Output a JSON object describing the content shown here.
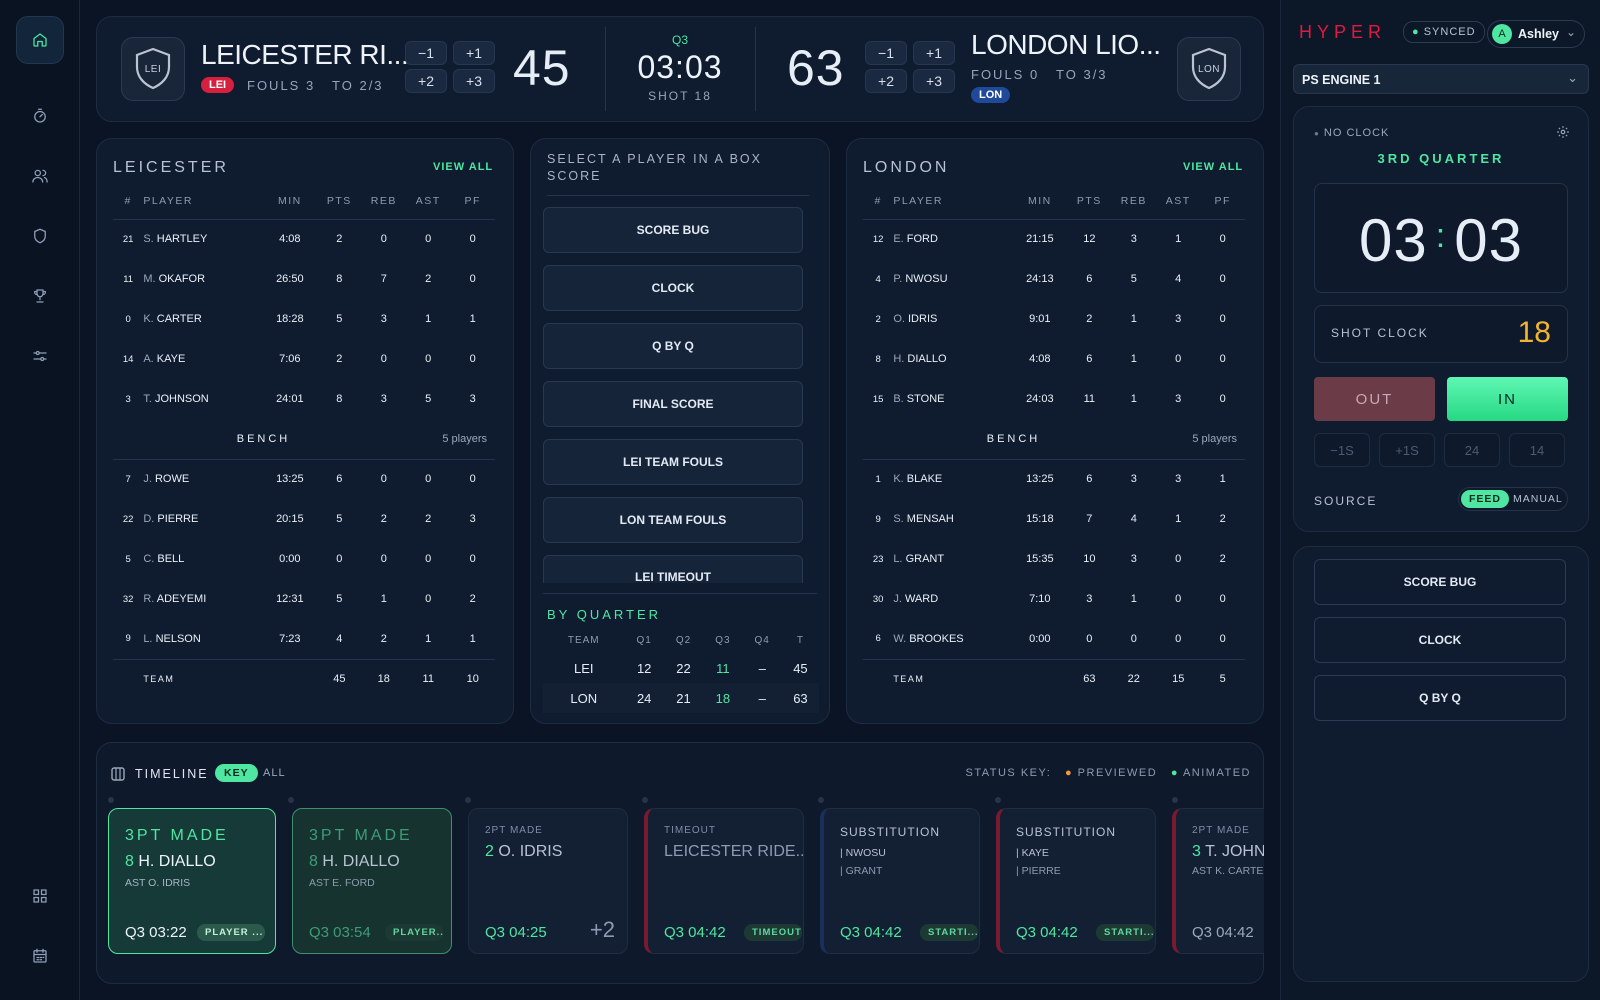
{
  "brand": {
    "logo": "HYPER",
    "sync_status": "SYNCED",
    "user_initial": "A",
    "user_name": "Ashley"
  },
  "engine": {
    "selected": "PS ENGINE 1"
  },
  "nav": {
    "icons": [
      "home-icon",
      "stopwatch-icon",
      "users-icon",
      "shield-icon",
      "trophy-icon",
      "sliders-icon",
      "grid-icon",
      "calendar-icon"
    ]
  },
  "scoreboard": {
    "home": {
      "name": "LEICESTER RI...",
      "abbr": "LEI",
      "fouls": "FOULS 3",
      "timeouts": "TO 2/3",
      "score": "45",
      "crest": "LEI",
      "color": "#d6203e"
    },
    "away": {
      "name": "LONDON LIO...",
      "abbr": "LON",
      "fouls": "FOULS 0",
      "timeouts": "TO 3/3",
      "score": "63",
      "crest": "LON",
      "color": "#1f4a9a"
    },
    "adjust": [
      "−1",
      "+1",
      "+2",
      "+3"
    ],
    "period": "Q3",
    "clock": "03:03",
    "shot": "SHOT 18"
  },
  "headers": [
    "#",
    "PLAYER",
    "MIN",
    "PTS",
    "REB",
    "AST",
    "PF"
  ],
  "leicester": {
    "title": "LEICESTER",
    "view_all": "VIEW ALL",
    "starters": [
      {
        "no": "21",
        "ini": "S.",
        "name": "HARTLEY",
        "min": "4:08",
        "pts": "2",
        "reb": "0",
        "ast": "0",
        "pf": "0"
      },
      {
        "no": "11",
        "ini": "M.",
        "name": "OKAFOR",
        "min": "26:50",
        "pts": "8",
        "reb": "7",
        "ast": "2",
        "pf": "0"
      },
      {
        "no": "0",
        "ini": "K.",
        "name": "CARTER",
        "min": "18:28",
        "pts": "5",
        "reb": "3",
        "ast": "1",
        "pf": "1"
      },
      {
        "no": "14",
        "ini": "A.",
        "name": "KAYE",
        "min": "7:06",
        "pts": "2",
        "reb": "0",
        "ast": "0",
        "pf": "0"
      },
      {
        "no": "3",
        "ini": "T.",
        "name": "JOHNSON",
        "min": "24:01",
        "pts": "8",
        "reb": "3",
        "ast": "5",
        "pf": "3"
      }
    ],
    "bench_label": "BENCH",
    "bench_count": "5 players",
    "bench": [
      {
        "no": "7",
        "ini": "J.",
        "name": "ROWE",
        "min": "13:25",
        "pts": "6",
        "reb": "0",
        "ast": "0",
        "pf": "0"
      },
      {
        "no": "22",
        "ini": "D.",
        "name": "PIERRE",
        "min": "20:15",
        "pts": "5",
        "reb": "2",
        "ast": "2",
        "pf": "3"
      },
      {
        "no": "5",
        "ini": "C.",
        "name": "BELL",
        "min": "0:00",
        "pts": "0",
        "reb": "0",
        "ast": "0",
        "pf": "0"
      },
      {
        "no": "32",
        "ini": "R.",
        "name": "ADEYEMI",
        "min": "12:31",
        "pts": "5",
        "reb": "1",
        "ast": "0",
        "pf": "2"
      },
      {
        "no": "9",
        "ini": "L.",
        "name": "NELSON",
        "min": "7:23",
        "pts": "4",
        "reb": "2",
        "ast": "1",
        "pf": "1"
      }
    ],
    "team": {
      "label": "TEAM",
      "pts": "45",
      "reb": "18",
      "ast": "11",
      "pf": "10"
    }
  },
  "london": {
    "title": "LONDON",
    "view_all": "VIEW ALL",
    "starters": [
      {
        "no": "12",
        "ini": "E.",
        "name": "FORD",
        "min": "21:15",
        "pts": "12",
        "reb": "3",
        "ast": "1",
        "pf": "0"
      },
      {
        "no": "4",
        "ini": "P.",
        "name": "NWOSU",
        "min": "24:13",
        "pts": "6",
        "reb": "5",
        "ast": "4",
        "pf": "0"
      },
      {
        "no": "2",
        "ini": "O.",
        "name": "IDRIS",
        "min": "9:01",
        "pts": "2",
        "reb": "1",
        "ast": "3",
        "pf": "0"
      },
      {
        "no": "8",
        "ini": "H.",
        "name": "DIALLO",
        "min": "4:08",
        "pts": "6",
        "reb": "1",
        "ast": "0",
        "pf": "0"
      },
      {
        "no": "15",
        "ini": "B.",
        "name": "STONE",
        "min": "24:03",
        "pts": "11",
        "reb": "1",
        "ast": "3",
        "pf": "0"
      }
    ],
    "bench_label": "BENCH",
    "bench_count": "5 players",
    "bench": [
      {
        "no": "1",
        "ini": "K.",
        "name": "BLAKE",
        "min": "13:25",
        "pts": "6",
        "reb": "3",
        "ast": "3",
        "pf": "1"
      },
      {
        "no": "9",
        "ini": "S.",
        "name": "MENSAH",
        "min": "15:18",
        "pts": "7",
        "reb": "4",
        "ast": "1",
        "pf": "2"
      },
      {
        "no": "23",
        "ini": "L.",
        "name": "GRANT",
        "min": "15:35",
        "pts": "10",
        "reb": "3",
        "ast": "0",
        "pf": "2"
      },
      {
        "no": "30",
        "ini": "J.",
        "name": "WARD",
        "min": "7:10",
        "pts": "3",
        "reb": "1",
        "ast": "0",
        "pf": "0"
      },
      {
        "no": "6",
        "ini": "W.",
        "name": "BROOKES",
        "min": "0:00",
        "pts": "0",
        "reb": "0",
        "ast": "0",
        "pf": "0"
      }
    ],
    "team": {
      "label": "TEAM",
      "pts": "63",
      "reb": "22",
      "ast": "15",
      "pf": "5"
    }
  },
  "graphics": {
    "prompt": "SELECT A PLAYER IN A BOX SCORE",
    "buttons": [
      "SCORE BUG",
      "CLOCK",
      "Q BY Q",
      "FINAL SCORE",
      "LEI TEAM FOULS",
      "LON TEAM FOULS",
      "LEI TIMEOUT"
    ]
  },
  "by_quarter": {
    "title": "BY QUARTER",
    "headers": [
      "TEAM",
      "Q1",
      "Q2",
      "Q3",
      "Q4",
      "T"
    ],
    "rows": [
      [
        "LEI",
        "12",
        "22",
        "11",
        "–",
        "45"
      ],
      [
        "LON",
        "24",
        "21",
        "18",
        "–",
        "63"
      ]
    ]
  },
  "timeline": {
    "title": "TIMELINE",
    "key": "KEY",
    "all": "ALL",
    "status_key": "STATUS KEY:",
    "previewed": "PREVIEWED",
    "animated": "ANIMATED",
    "cards": [
      {
        "type": "3PT MADE",
        "num": "8",
        "player": "H. DIALLO",
        "sub": "AST O. IDRIS",
        "time": "Q3 03:22",
        "pill": "PLAYER ..."
      },
      {
        "type": "3PT MADE",
        "num": "8",
        "player": "H. DIALLO",
        "sub": "AST E. FORD",
        "time": "Q3 03:54",
        "pill": "PLAYER..."
      },
      {
        "type": "2PT MADE",
        "num": "2",
        "player": "O. IDRIS",
        "time": "Q3 04:25",
        "extra": "+2"
      },
      {
        "type": "TIMEOUT",
        "player": "LEICESTER RIDE...",
        "time": "Q3 04:42",
        "pill": "TIMEOUT"
      },
      {
        "type": "SUBSTITUTION",
        "in": "| NWOSU",
        "out": "| GRANT",
        "time": "Q3 04:42",
        "pill": "STARTI..."
      },
      {
        "type": "SUBSTITUTION",
        "in": "| KAYE",
        "out": "| PIERRE",
        "time": "Q3 04:42",
        "pill": "STARTI..."
      },
      {
        "type": "2PT MADE",
        "num": "3",
        "player": "T. JOHNS",
        "sub": "AST K. CARTER",
        "time": "Q3 04:42"
      }
    ]
  },
  "clock_panel": {
    "no_clock": "NO CLOCK",
    "quarter": "3RD QUARTER",
    "minutes": "03",
    "sep": ":",
    "seconds": "03",
    "shot_label": "SHOT CLOCK",
    "shot_value": "18",
    "out": "OUT",
    "in": "IN",
    "small": [
      "−1S",
      "+1S",
      "24",
      "14"
    ],
    "source_label": "SOURCE",
    "feed": "FEED",
    "manual": "MANUAL"
  },
  "quick_buttons": [
    "SCORE BUG",
    "CLOCK",
    "Q BY Q"
  ],
  "colors": {
    "accent": "#4ee6a0",
    "home": "#d6203e",
    "away": "#1f4a9a",
    "shot": "#f2b430",
    "brand": "#e3193f"
  }
}
